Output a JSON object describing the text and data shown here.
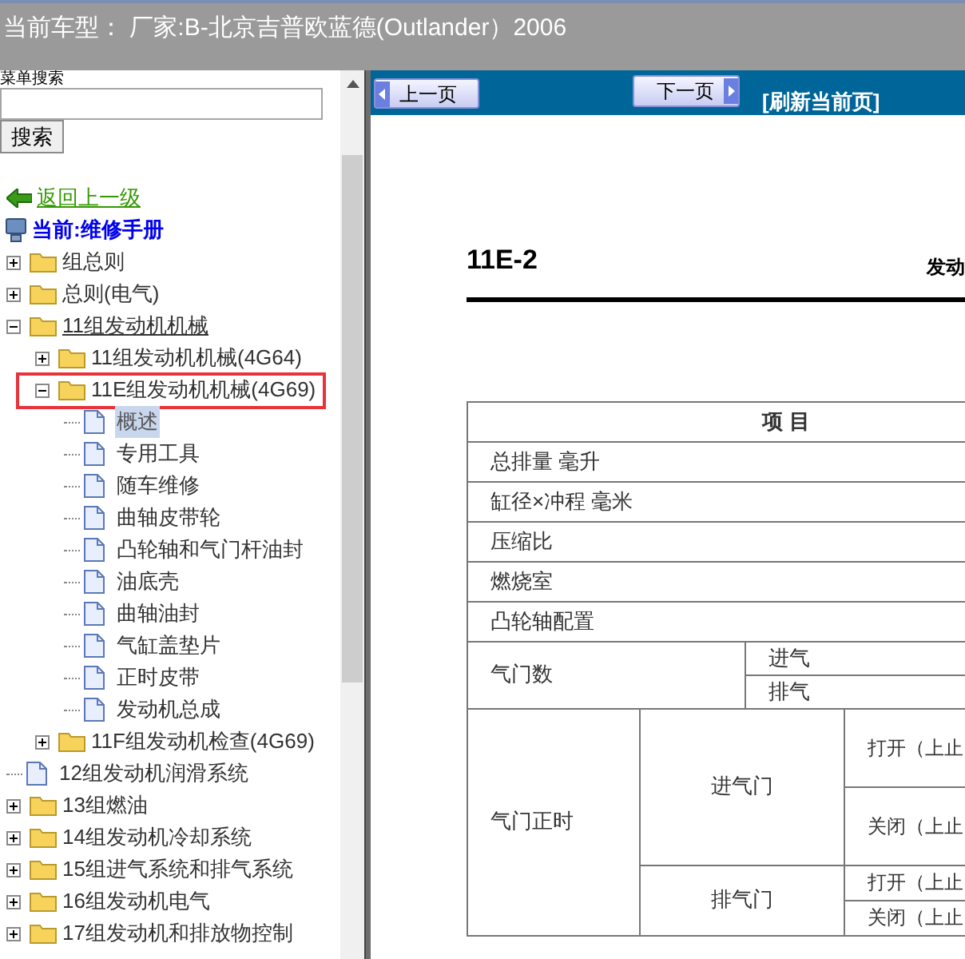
{
  "header": {
    "text": "当前车型：  厂家:B-北京吉普欧蓝德(Outlander）2006"
  },
  "sidebar": {
    "search_label": "菜单搜索",
    "search_button": "搜索",
    "back_link": "返回上一级",
    "current": "当前:维修手册",
    "tree": [
      {
        "label": "组总则",
        "kind": "folder",
        "expanded": false,
        "selected": false,
        "underlined": false,
        "marked": false
      },
      {
        "label": "总则(电气)",
        "kind": "folder",
        "expanded": false,
        "selected": false,
        "underlined": false,
        "marked": false
      },
      {
        "label": "11组发动机机械",
        "kind": "folder",
        "expanded": true,
        "selected": false,
        "underlined": true,
        "marked": false,
        "children": [
          {
            "label": "11组发动机机械(4G64)",
            "kind": "folder",
            "expanded": false,
            "selected": false,
            "underlined": false,
            "marked": false
          },
          {
            "label": "11E组发动机机械(4G69)",
            "kind": "folder",
            "expanded": true,
            "selected": false,
            "underlined": false,
            "marked": true,
            "children": [
              {
                "label": "概述",
                "kind": "page",
                "selected": true,
                "underlined": false,
                "marked": false
              },
              {
                "label": "专用工具",
                "kind": "page",
                "selected": false,
                "underlined": false,
                "marked": false
              },
              {
                "label": "随车维修",
                "kind": "page",
                "selected": false,
                "underlined": false,
                "marked": false
              },
              {
                "label": "曲轴皮带轮",
                "kind": "page",
                "selected": false,
                "underlined": false,
                "marked": false
              },
              {
                "label": "凸轮轴和气门杆油封",
                "kind": "page",
                "selected": false,
                "underlined": false,
                "marked": false
              },
              {
                "label": "油底壳",
                "kind": "page",
                "selected": false,
                "underlined": false,
                "marked": false
              },
              {
                "label": "曲轴油封",
                "kind": "page",
                "selected": false,
                "underlined": false,
                "marked": false
              },
              {
                "label": "气缸盖垫片",
                "kind": "page",
                "selected": false,
                "underlined": false,
                "marked": false
              },
              {
                "label": "正时皮带",
                "kind": "page",
                "selected": false,
                "underlined": false,
                "marked": false
              },
              {
                "label": "发动机总成",
                "kind": "page",
                "selected": false,
                "underlined": false,
                "marked": false
              }
            ]
          },
          {
            "label": "11F组发动机检查(4G69)",
            "kind": "folder",
            "expanded": false,
            "selected": false,
            "underlined": false,
            "marked": false
          }
        ]
      },
      {
        "label": "12组发动机润滑系统",
        "kind": "page",
        "selected": false,
        "underlined": false,
        "marked": false
      },
      {
        "label": "13组燃油",
        "kind": "folder",
        "expanded": false,
        "selected": false,
        "underlined": false,
        "marked": false
      },
      {
        "label": "14组发动机冷却系统",
        "kind": "folder",
        "expanded": false,
        "selected": false,
        "underlined": false,
        "marked": false
      },
      {
        "label": "15组进气系统和排气系统",
        "kind": "folder",
        "expanded": false,
        "selected": false,
        "underlined": false,
        "marked": false
      },
      {
        "label": "16组发动机电气",
        "kind": "folder",
        "expanded": false,
        "selected": false,
        "underlined": false,
        "marked": false
      },
      {
        "label": "17组发动机和排放物控制",
        "kind": "folder",
        "expanded": false,
        "selected": false,
        "underlined": false,
        "marked": false
      }
    ]
  },
  "toolbar": {
    "prev": "上一页",
    "next": "下一页",
    "refresh": "[刷新当前页]"
  },
  "document": {
    "page_number": "11E-2",
    "title": "发动",
    "table": {
      "heading": "项 目",
      "rows": [
        {
          "kind": "simple",
          "label": "总排量 毫升"
        },
        {
          "kind": "simple",
          "label": "缸径×冲程 毫米"
        },
        {
          "kind": "simple",
          "label": "压缩比"
        },
        {
          "kind": "simple",
          "label": "燃烧室"
        },
        {
          "kind": "simple",
          "label": "凸轮轴配置"
        },
        {
          "kind": "split",
          "label": "气门数",
          "parts": [
            "进气",
            "排气"
          ]
        },
        {
          "kind": "timing",
          "label": "气门正时",
          "groups": [
            {
              "label": "进气门",
              "parts": [
                "打开（上止",
                "关闭（上止"
              ]
            },
            {
              "label": "排气门",
              "parts": [
                "打开（上止",
                "关闭（上止"
              ]
            }
          ]
        }
      ]
    }
  }
}
